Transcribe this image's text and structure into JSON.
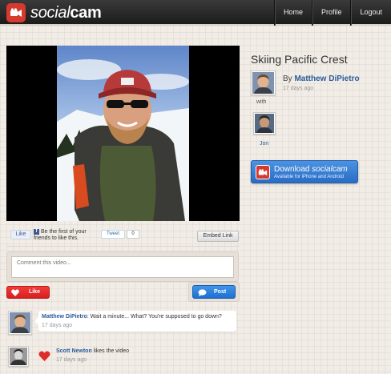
{
  "header": {
    "logo_text_part1": "social",
    "logo_text_part2": "cam",
    "nav": [
      "Home",
      "Profile",
      "Logout"
    ]
  },
  "video": {
    "title": "Skiing Pacific Crest",
    "by_prefix": "By ",
    "author": "Matthew DiPietro",
    "posted_ago": "17 days ago",
    "with_label": "with",
    "collaborator": "Jon"
  },
  "download": {
    "label_part1": "Download ",
    "label_part2": "socialcam",
    "sublabel": "Available for iPhone and Android"
  },
  "social": {
    "fb_like_label": "Like",
    "fb_text": "Be the first of your friends to like this.",
    "tweet_label": "Tweet",
    "tweet_count": "0",
    "embed_label": "Embed Link"
  },
  "comment": {
    "placeholder": "Comment this video...",
    "like_label": "Like",
    "post_label": "Post"
  },
  "activity": [
    {
      "name": "Matthew DiPietro",
      "text": ": Wait a minute... What? You're supposed to go down?",
      "ago": "17 days ago"
    },
    {
      "name": "Scott Newton",
      "text": " likes the video",
      "ago": "17 days ago"
    }
  ],
  "colors": {
    "brand_red": "#d63a2f",
    "link_blue": "#2b5c98",
    "download_blue": "#2a6cc5",
    "like_red": "#e02b2b",
    "post_blue": "#1f6fd0"
  },
  "icons": [
    "camera-icon",
    "heart-icon",
    "speech-bubble-icon",
    "facebook-icon",
    "twitter-icon"
  ]
}
